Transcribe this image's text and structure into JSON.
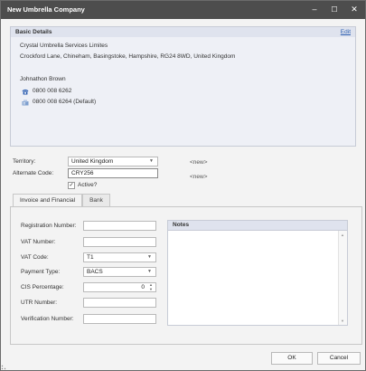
{
  "window": {
    "title": "New Umbrella Company",
    "minimize": "–",
    "maximize": "☐",
    "close": "✕"
  },
  "basic_details": {
    "header": "Basic Details",
    "edit_link": "Edit",
    "company_name": "Crystal Umbrella Services Limites",
    "address": "Crockford Lane, Chineham, Basingstoke, Hampshire, RG24 8WD, United Kingdom",
    "contact_name": "Johnathon Brown",
    "phone": "0800 008 6262",
    "fax": "0800 008 6264  (Default)"
  },
  "form": {
    "territory_label": "Territory:",
    "territory_value": "United Kingdom",
    "alternate_code_label": "Alternate Code:",
    "alternate_code_value": "CRY256",
    "active_label": "Active?",
    "active_checked": "✓",
    "new_placeholder_1": "<new>",
    "new_placeholder_2": "<new>"
  },
  "tabs": [
    {
      "label": "Invoice and Financial",
      "active": true
    },
    {
      "label": "Bank",
      "active": false
    }
  ],
  "invoice": {
    "registration_number_label": "Registration Number:",
    "registration_number_value": "",
    "vat_number_label": "VAT Number:",
    "vat_number_value": "",
    "vat_code_label": "VAT Code:",
    "vat_code_value": "T1",
    "payment_type_label": "Payment Type:",
    "payment_type_value": "BACS",
    "cis_percentage_label": "CIS Percentage:",
    "cis_percentage_value": "0",
    "utr_number_label": "UTR Number:",
    "utr_number_value": "",
    "verification_number_label": "Verification Number:",
    "verification_number_value": ""
  },
  "notes": {
    "header": "Notes",
    "content": ""
  },
  "buttons": {
    "ok": "OK",
    "cancel": "Cancel"
  },
  "colors": {
    "titlebar": "#4d4d4d",
    "panel_header": "#dfe3ee",
    "link": "#2a5db0",
    "accent_icon": "#2a5db0"
  }
}
